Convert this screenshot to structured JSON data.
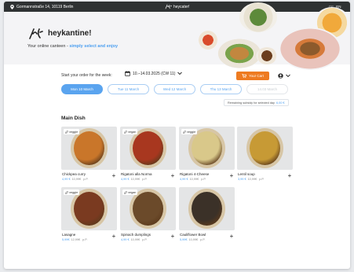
{
  "topbar": {
    "address": "Gormannstraße 14, 10119 Berlin",
    "brand": "heycater!",
    "languages": [
      {
        "code": "DE",
        "active": false
      },
      {
        "code": "EN",
        "active": true
      }
    ]
  },
  "hero": {
    "logo_text": "heykantine!",
    "tagline_prefix": "Your online canteen - ",
    "tagline_highlight": "simply select and enjoy"
  },
  "order": {
    "start_label": "Start your order for the week:",
    "date_range": "10.–14.03.2025 (CW 11)"
  },
  "cart": {
    "label": "Your Cart",
    "accent": "#ee7b21"
  },
  "days": [
    {
      "label": "Mon 10 March",
      "state": "active"
    },
    {
      "label": "Tue 11 March",
      "state": "default"
    },
    {
      "label": "Wed 12 March",
      "state": "default"
    },
    {
      "label": "Thu 13 March",
      "state": "default"
    },
    {
      "label": "14.03 March",
      "state": "disabled"
    }
  ],
  "subsidy": {
    "label": "Remaining subsidy for selected day",
    "amount": "6,00 €"
  },
  "section": {
    "title": "Main Dish"
  },
  "dishes": [
    {
      "name": "Chickpea curry",
      "badge": "veggie",
      "price": "4,99 €",
      "old": "10,99€",
      "unit": "p.P.",
      "food_color": "#c9762a"
    },
    {
      "name": "Rigatoni alla Norma",
      "badge": "vegan",
      "price": "4,99 €",
      "old": "10,99€",
      "unit": "p.P.",
      "food_color": "#a8371f"
    },
    {
      "name": "Rigatoni 4-Cheese",
      "badge": "veggie",
      "price": "4,99 €",
      "old": "10,99€",
      "unit": "p.P.",
      "food_color": "#d9c88a"
    },
    {
      "name": "Lentil soup",
      "badge": "",
      "price": "3,99 €",
      "old": "10,99€",
      "unit": "p.P.",
      "food_color": "#c79a35"
    },
    {
      "name": "Lasagne",
      "badge": "veggie",
      "price": "5,99€",
      "old": "12,99€",
      "unit": "p.P.",
      "food_color": "#7a3a20"
    },
    {
      "name": "Spinach dumplings",
      "badge": "vegan",
      "price": "4,99 €",
      "old": "10,99€",
      "unit": "p.P.",
      "food_color": "#6b4a2a"
    },
    {
      "name": "Cauliflower Bowl",
      "badge": "",
      "price": "5,99€",
      "old": "10,99€",
      "unit": "p.P.",
      "food_color": "#3b3128"
    }
  ],
  "colors": {
    "accent_blue": "#5aa4ef",
    "topbar": "#2f3233"
  }
}
